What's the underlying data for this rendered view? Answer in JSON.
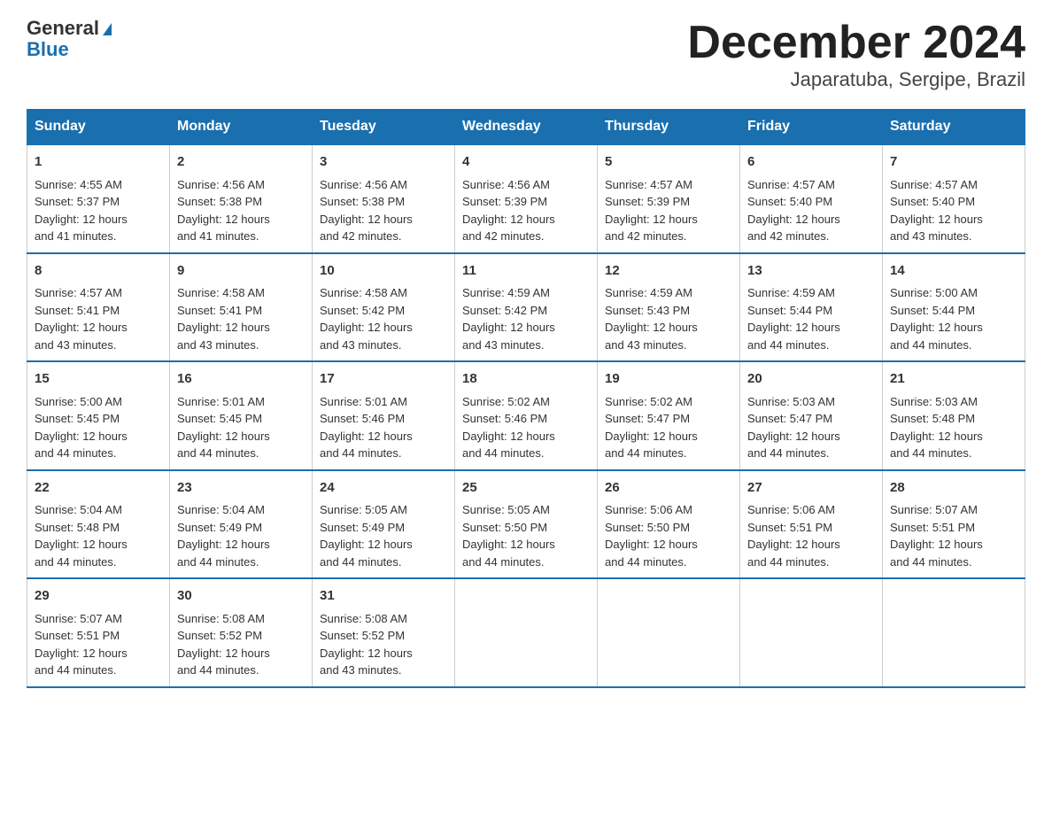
{
  "header": {
    "logo_general": "General",
    "logo_blue": "Blue",
    "title": "December 2024",
    "subtitle": "Japaratuba, Sergipe, Brazil"
  },
  "days_of_week": [
    "Sunday",
    "Monday",
    "Tuesday",
    "Wednesday",
    "Thursday",
    "Friday",
    "Saturday"
  ],
  "weeks": [
    [
      {
        "day": "1",
        "sunrise": "4:55 AM",
        "sunset": "5:37 PM",
        "daylight": "12 hours and 41 minutes."
      },
      {
        "day": "2",
        "sunrise": "4:56 AM",
        "sunset": "5:38 PM",
        "daylight": "12 hours and 41 minutes."
      },
      {
        "day": "3",
        "sunrise": "4:56 AM",
        "sunset": "5:38 PM",
        "daylight": "12 hours and 42 minutes."
      },
      {
        "day": "4",
        "sunrise": "4:56 AM",
        "sunset": "5:39 PM",
        "daylight": "12 hours and 42 minutes."
      },
      {
        "day": "5",
        "sunrise": "4:57 AM",
        "sunset": "5:39 PM",
        "daylight": "12 hours and 42 minutes."
      },
      {
        "day": "6",
        "sunrise": "4:57 AM",
        "sunset": "5:40 PM",
        "daylight": "12 hours and 42 minutes."
      },
      {
        "day": "7",
        "sunrise": "4:57 AM",
        "sunset": "5:40 PM",
        "daylight": "12 hours and 43 minutes."
      }
    ],
    [
      {
        "day": "8",
        "sunrise": "4:57 AM",
        "sunset": "5:41 PM",
        "daylight": "12 hours and 43 minutes."
      },
      {
        "day": "9",
        "sunrise": "4:58 AM",
        "sunset": "5:41 PM",
        "daylight": "12 hours and 43 minutes."
      },
      {
        "day": "10",
        "sunrise": "4:58 AM",
        "sunset": "5:42 PM",
        "daylight": "12 hours and 43 minutes."
      },
      {
        "day": "11",
        "sunrise": "4:59 AM",
        "sunset": "5:42 PM",
        "daylight": "12 hours and 43 minutes."
      },
      {
        "day": "12",
        "sunrise": "4:59 AM",
        "sunset": "5:43 PM",
        "daylight": "12 hours and 43 minutes."
      },
      {
        "day": "13",
        "sunrise": "4:59 AM",
        "sunset": "5:44 PM",
        "daylight": "12 hours and 44 minutes."
      },
      {
        "day": "14",
        "sunrise": "5:00 AM",
        "sunset": "5:44 PM",
        "daylight": "12 hours and 44 minutes."
      }
    ],
    [
      {
        "day": "15",
        "sunrise": "5:00 AM",
        "sunset": "5:45 PM",
        "daylight": "12 hours and 44 minutes."
      },
      {
        "day": "16",
        "sunrise": "5:01 AM",
        "sunset": "5:45 PM",
        "daylight": "12 hours and 44 minutes."
      },
      {
        "day": "17",
        "sunrise": "5:01 AM",
        "sunset": "5:46 PM",
        "daylight": "12 hours and 44 minutes."
      },
      {
        "day": "18",
        "sunrise": "5:02 AM",
        "sunset": "5:46 PM",
        "daylight": "12 hours and 44 minutes."
      },
      {
        "day": "19",
        "sunrise": "5:02 AM",
        "sunset": "5:47 PM",
        "daylight": "12 hours and 44 minutes."
      },
      {
        "day": "20",
        "sunrise": "5:03 AM",
        "sunset": "5:47 PM",
        "daylight": "12 hours and 44 minutes."
      },
      {
        "day": "21",
        "sunrise": "5:03 AM",
        "sunset": "5:48 PM",
        "daylight": "12 hours and 44 minutes."
      }
    ],
    [
      {
        "day": "22",
        "sunrise": "5:04 AM",
        "sunset": "5:48 PM",
        "daylight": "12 hours and 44 minutes."
      },
      {
        "day": "23",
        "sunrise": "5:04 AM",
        "sunset": "5:49 PM",
        "daylight": "12 hours and 44 minutes."
      },
      {
        "day": "24",
        "sunrise": "5:05 AM",
        "sunset": "5:49 PM",
        "daylight": "12 hours and 44 minutes."
      },
      {
        "day": "25",
        "sunrise": "5:05 AM",
        "sunset": "5:50 PM",
        "daylight": "12 hours and 44 minutes."
      },
      {
        "day": "26",
        "sunrise": "5:06 AM",
        "sunset": "5:50 PM",
        "daylight": "12 hours and 44 minutes."
      },
      {
        "day": "27",
        "sunrise": "5:06 AM",
        "sunset": "5:51 PM",
        "daylight": "12 hours and 44 minutes."
      },
      {
        "day": "28",
        "sunrise": "5:07 AM",
        "sunset": "5:51 PM",
        "daylight": "12 hours and 44 minutes."
      }
    ],
    [
      {
        "day": "29",
        "sunrise": "5:07 AM",
        "sunset": "5:51 PM",
        "daylight": "12 hours and 44 minutes."
      },
      {
        "day": "30",
        "sunrise": "5:08 AM",
        "sunset": "5:52 PM",
        "daylight": "12 hours and 44 minutes."
      },
      {
        "day": "31",
        "sunrise": "5:08 AM",
        "sunset": "5:52 PM",
        "daylight": "12 hours and 43 minutes."
      },
      null,
      null,
      null,
      null
    ]
  ],
  "labels": {
    "sunrise": "Sunrise:",
    "sunset": "Sunset:",
    "daylight": "Daylight:"
  }
}
